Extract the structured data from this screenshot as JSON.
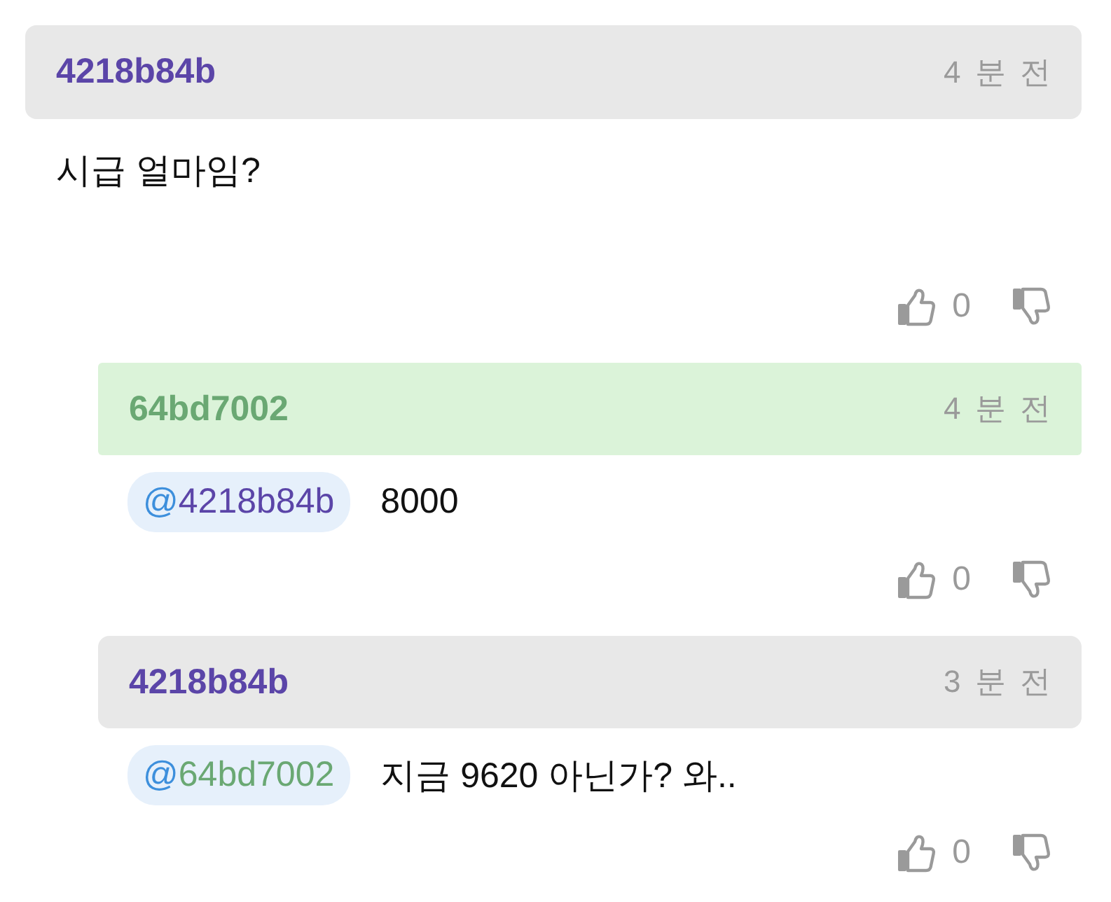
{
  "comments": [
    {
      "author": "4218b84b",
      "color": "#5b45a8",
      "highlighted": false,
      "time": "4 분 전",
      "text": "시급 얼마임?",
      "likes": "0",
      "children": [
        {
          "author": "64bd7002",
          "color": "#6aa873",
          "highlighted": true,
          "time": "4 분 전",
          "mention": {
            "symbol": "@",
            "user": "4218b84b",
            "color": "#5b45a8"
          },
          "text": "8000",
          "likes": "0"
        },
        {
          "author": "4218b84b",
          "color": "#5b45a8",
          "highlighted": false,
          "time": "3 분 전",
          "mention": {
            "symbol": "@",
            "user": "64bd7002",
            "color": "#6aa873"
          },
          "text": "지금 9620 아닌가? 와..",
          "likes": "0"
        }
      ]
    }
  ]
}
